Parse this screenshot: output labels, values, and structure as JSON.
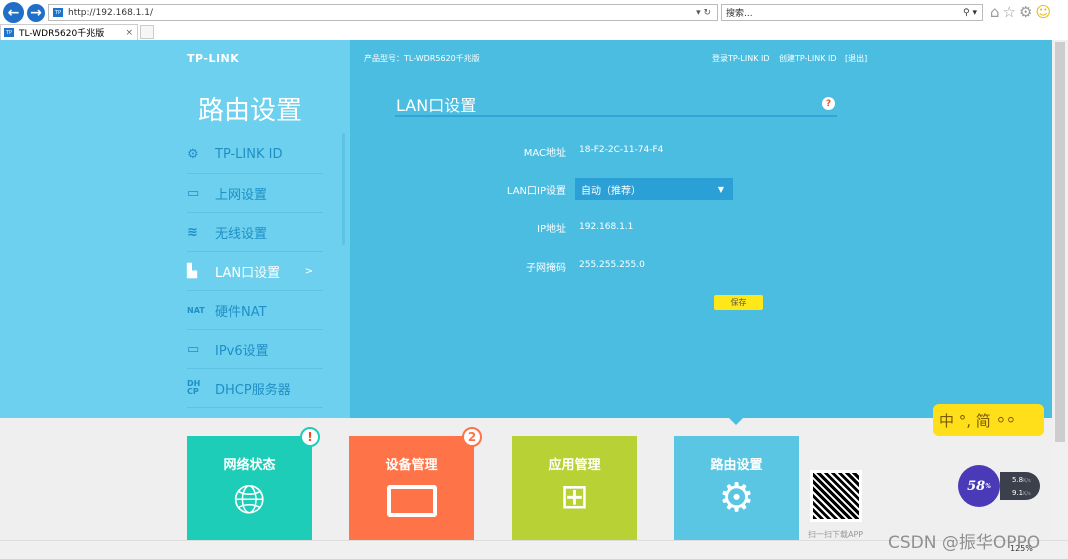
{
  "browser": {
    "url": "http://192.168.1.1/",
    "search_placeholder": "搜索...",
    "tab_title": "TL-WDR5620千兆版",
    "favicon": "TP",
    "zoom": "125%"
  },
  "header": {
    "logo": "TP-LINK",
    "model": "产品型号：TL-WDR5620千兆版",
    "login": "登录TP-LINK ID",
    "create": "创建TP-LINK ID",
    "logout": "[退出]"
  },
  "sidebar": {
    "title": "路由设置",
    "items": [
      {
        "label": "TP-LINK ID",
        "icon": "gear-icon"
      },
      {
        "label": "上网设置",
        "icon": "laptop-icon"
      },
      {
        "label": "无线设置",
        "icon": "wifi-icon"
      },
      {
        "label": "LAN口设置",
        "icon": "router-icon",
        "arrow": ">"
      },
      {
        "label": "硬件NAT",
        "icon": "nat-icon"
      },
      {
        "label": "IPv6设置",
        "icon": "laptop-icon"
      },
      {
        "label": "DHCP服务器",
        "icon": "dhcp-icon"
      }
    ]
  },
  "main": {
    "title": "LAN口设置",
    "help": "?",
    "fields": [
      {
        "label": "MAC地址",
        "value": "18-F2-2C-11-74-F4"
      },
      {
        "label": "LAN口IP设置",
        "value": "自动（推荐）"
      },
      {
        "label": "IP地址",
        "value": "192.168.1.1"
      },
      {
        "label": "子网掩码",
        "value": "255.255.255.0"
      }
    ],
    "save": "保存"
  },
  "tiles": [
    {
      "label": "网络状态",
      "badge": "!",
      "color": "#1ecdb8"
    },
    {
      "label": "设备管理",
      "badge": "2",
      "color": "#ff7348"
    },
    {
      "label": "应用管理",
      "color": "#b8d235"
    },
    {
      "label": "路由设置",
      "color": "#5bc6e4"
    }
  ],
  "qr": {
    "caption": "扫一扫下载APP"
  },
  "ime": {
    "text": "中 °, 简"
  },
  "speed": {
    "percent": "58",
    "unit": "%",
    "up": "5.8",
    "down": "9.1",
    "rate_unit": "K/s"
  },
  "watermark": "CSDN @振华OPPO"
}
